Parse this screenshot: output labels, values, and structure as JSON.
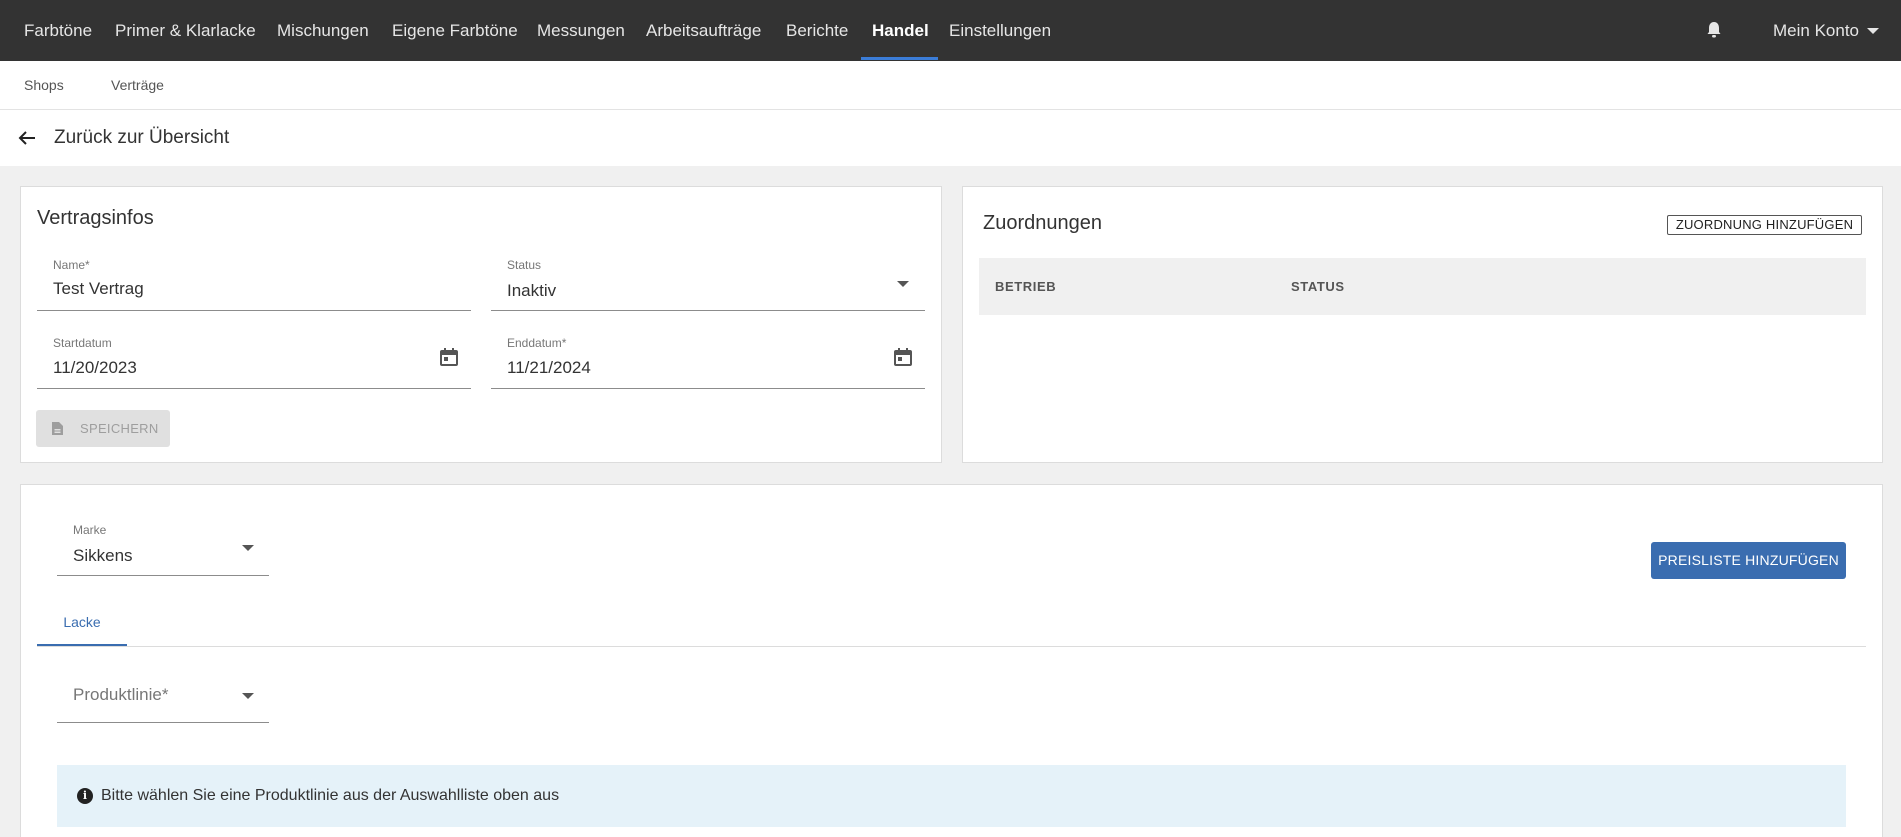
{
  "topnav": {
    "items": [
      "Farbtöne",
      "Primer & Klarlacke",
      "Mischungen",
      "Eigene Farbtöne",
      "Messungen",
      "Arbeitsaufträge",
      "Berichte",
      "Handel",
      "Einstellungen"
    ],
    "active_item": "Handel",
    "account_label": "Mein Konto"
  },
  "subnav": {
    "items": [
      "Shops",
      "Verträge"
    ]
  },
  "back": {
    "label": "Zurück zur Übersicht"
  },
  "contract_info": {
    "title": "Vertragsinfos",
    "name": {
      "label": "Name*",
      "value": "Test Vertrag"
    },
    "status": {
      "label": "Status",
      "value": "Inaktiv"
    },
    "start_date": {
      "label": "Startdatum",
      "value": "11/20/2023"
    },
    "end_date": {
      "label": "Enddatum*",
      "value": "11/21/2024"
    },
    "save_label": "SPEICHERN"
  },
  "assignments": {
    "title": "Zuordnungen",
    "add_label": "ZUORDNUNG HINZUFÜGEN",
    "columns": [
      "BETRIEB",
      "STATUS"
    ],
    "rows": []
  },
  "pricing": {
    "brand": {
      "label": "Marke",
      "value": "Sikkens"
    },
    "add_pricelist_label": "PREISLISTE HINZUFÜGEN",
    "tabs": [
      "Lacke"
    ],
    "product_line": {
      "placeholder": "Produktlinie*"
    },
    "info_message": "Bitte wählen Sie eine Produktlinie aus der Auswahlliste oben aus"
  },
  "colors": {
    "topnav_bg": "#333333",
    "accent": "#3a6db0",
    "active_underline": "#3b7dd8",
    "info_bg": "#e5f2f9"
  }
}
